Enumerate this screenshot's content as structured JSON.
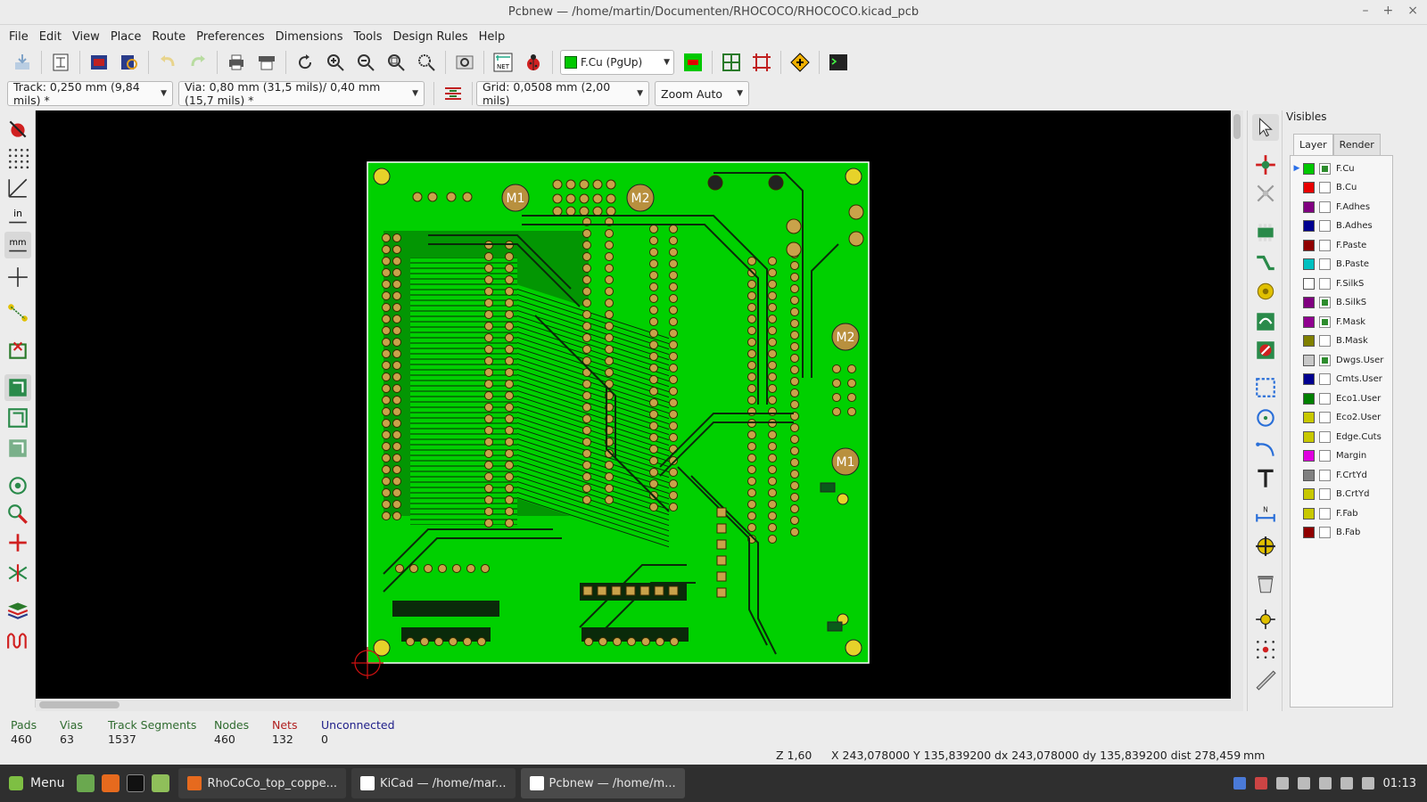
{
  "window": {
    "title": "Pcbnew — /home/martin/Documenten/RHOCOCO/RHOCOCO.kicad_pcb"
  },
  "menu": [
    "File",
    "Edit",
    "View",
    "Place",
    "Route",
    "Preferences",
    "Dimensions",
    "Tools",
    "Design Rules",
    "Help"
  ],
  "toolbar": {
    "active_layer": "F.Cu (PgUp)",
    "active_layer_color": "#00c800"
  },
  "options": {
    "track": "Track: 0,250 mm (9,84 mils) *",
    "via": "Via: 0,80 mm (31,5 mils)/ 0,40 mm (15,7 mils) *",
    "grid": "Grid: 0,0508 mm (2,00 mils)",
    "zoom": "Zoom Auto"
  },
  "board": {
    "copper_color": "#00d000",
    "background_color": "#000000",
    "labels": [
      "M1",
      "M2",
      "M2",
      "M1"
    ]
  },
  "visibles": {
    "title": "Visibles",
    "tabs": [
      "Layer",
      "Render"
    ],
    "layers": [
      {
        "name": "F.Cu",
        "color": "#00c800",
        "checked": true,
        "active": true
      },
      {
        "name": "B.Cu",
        "color": "#e80000",
        "checked": false
      },
      {
        "name": "F.Adhes",
        "color": "#800080",
        "checked": false
      },
      {
        "name": "B.Adhes",
        "color": "#000090",
        "checked": false
      },
      {
        "name": "F.Paste",
        "color": "#900000",
        "checked": false
      },
      {
        "name": "B.Paste",
        "color": "#00c0c0",
        "checked": false
      },
      {
        "name": "F.SilkS",
        "color": "#ffffff",
        "checked": false
      },
      {
        "name": "B.SilkS",
        "color": "#800080",
        "checked": true
      },
      {
        "name": "F.Mask",
        "color": "#900090",
        "checked": true
      },
      {
        "name": "B.Mask",
        "color": "#808000",
        "checked": false
      },
      {
        "name": "Dwgs.User",
        "color": "#c8c8c8",
        "checked": true
      },
      {
        "name": "Cmts.User",
        "color": "#000090",
        "checked": false
      },
      {
        "name": "Eco1.User",
        "color": "#008000",
        "checked": false
      },
      {
        "name": "Eco2.User",
        "color": "#c8c800",
        "checked": false
      },
      {
        "name": "Edge.Cuts",
        "color": "#c8c800",
        "checked": false
      },
      {
        "name": "Margin",
        "color": "#e000e0",
        "checked": false
      },
      {
        "name": "F.CrtYd",
        "color": "#808080",
        "checked": false
      },
      {
        "name": "B.CrtYd",
        "color": "#c8c800",
        "checked": false
      },
      {
        "name": "F.Fab",
        "color": "#c8c800",
        "checked": false
      },
      {
        "name": "B.Fab",
        "color": "#900000",
        "checked": false
      }
    ]
  },
  "stats": {
    "pads_label": "Pads",
    "pads": "460",
    "vias_label": "Vias",
    "vias": "63",
    "tracks_label": "Track Segments",
    "tracks": "1537",
    "nodes_label": "Nodes",
    "nodes": "460",
    "nets_label": "Nets",
    "nets": "132",
    "unconnected_label": "Unconnected",
    "unconnected": "0"
  },
  "coords": {
    "zoom": "Z 1,60",
    "xy": "X 243,078000  Y 135,839200",
    "delta": "dx 243,078000  dy 135,839200  dist 278,459",
    "units": "mm"
  },
  "taskbar": {
    "menu": "Menu",
    "tasks": [
      "RhoCoCo_top_coppe...",
      "KiCad — /home/mar...",
      "Pcbnew — /home/m..."
    ],
    "clock": "01:13"
  }
}
